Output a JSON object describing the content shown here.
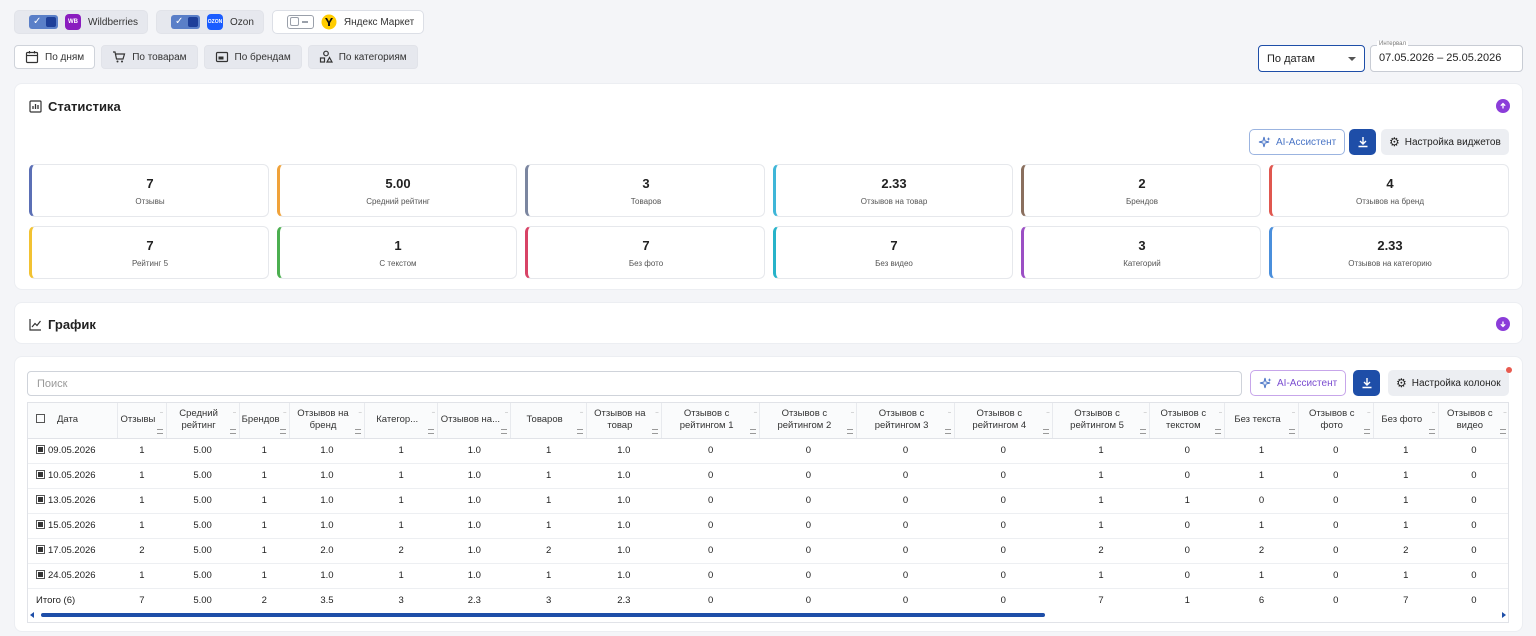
{
  "marketplaces": [
    {
      "name": "Wildberries",
      "enabled": true,
      "logo": "WB"
    },
    {
      "name": "Ozon",
      "enabled": true,
      "logo": "OZON"
    },
    {
      "name": "Яндекс Маркет",
      "enabled": false,
      "logo": ""
    }
  ],
  "views": [
    {
      "label": "По дням",
      "icon": "calendar-icon",
      "active": true
    },
    {
      "label": "По товарам",
      "icon": "cart-icon",
      "active": false
    },
    {
      "label": "По брендам",
      "icon": "brand-icon",
      "active": false
    },
    {
      "label": "По категориям",
      "icon": "category-icon",
      "active": false
    }
  ],
  "date_mode": {
    "value": "По датам"
  },
  "interval": {
    "label": "Интервал",
    "value": "07.05.2026 – 25.05.2026"
  },
  "stats": {
    "title": "Статистика",
    "ai_label": "AI-Ассистент",
    "settings_label": "Настройка виджетов",
    "tiles": [
      {
        "value": "7",
        "label": "Отзывы",
        "color": "#5b6fb5"
      },
      {
        "value": "5.00",
        "label": "Средний рейтинг",
        "color": "#f0a23a"
      },
      {
        "value": "3",
        "label": "Товаров",
        "color": "#7b86a0"
      },
      {
        "value": "2.33",
        "label": "Отзывов на товар",
        "color": "#3fb6d8"
      },
      {
        "value": "2",
        "label": "Брендов",
        "color": "#8a6f5e"
      },
      {
        "value": "4",
        "label": "Отзывов на бренд",
        "color": "#e0574f"
      },
      {
        "value": "7",
        "label": "Рейтинг 5",
        "color": "#f2c232"
      },
      {
        "value": "1",
        "label": "С текстом",
        "color": "#4caf50"
      },
      {
        "value": "7",
        "label": "Без фото",
        "color": "#d84366"
      },
      {
        "value": "7",
        "label": "Без видео",
        "color": "#27b3c9"
      },
      {
        "value": "3",
        "label": "Категорий",
        "color": "#9b4fc4"
      },
      {
        "value": "2.33",
        "label": "Отзывов на категорию",
        "color": "#4a8fdc"
      }
    ]
  },
  "chart": {
    "title": "График"
  },
  "table": {
    "search_placeholder": "Поиск",
    "ai_label": "AI-Ассистент",
    "settings_label": "Настройка колонок",
    "columns": [
      "Дата",
      "Отзывы",
      "Средний рейтинг",
      "Брендов",
      "Отзывов на бренд",
      "Категор...",
      "Отзывов на...",
      "Товаров",
      "Отзывов на товар",
      "Отзывов с рейтингом 1",
      "Отзывов с рейтингом 2",
      "Отзывов с рейтингом 3",
      "Отзывов с рейтингом 4",
      "Отзывов с рейтингом 5",
      "Отзывов с текстом",
      "Без текста",
      "Отзывов с фото",
      "Без фото",
      "Отзывов с видео"
    ],
    "rows": [
      [
        "09.05.2026",
        "1",
        "5.00",
        "1",
        "1.0",
        "1",
        "1.0",
        "1",
        "1.0",
        "0",
        "0",
        "0",
        "0",
        "1",
        "0",
        "1",
        "0",
        "1",
        "0"
      ],
      [
        "10.05.2026",
        "1",
        "5.00",
        "1",
        "1.0",
        "1",
        "1.0",
        "1",
        "1.0",
        "0",
        "0",
        "0",
        "0",
        "1",
        "0",
        "1",
        "0",
        "1",
        "0"
      ],
      [
        "13.05.2026",
        "1",
        "5.00",
        "1",
        "1.0",
        "1",
        "1.0",
        "1",
        "1.0",
        "0",
        "0",
        "0",
        "0",
        "1",
        "1",
        "0",
        "0",
        "1",
        "0"
      ],
      [
        "15.05.2026",
        "1",
        "5.00",
        "1",
        "1.0",
        "1",
        "1.0",
        "1",
        "1.0",
        "0",
        "0",
        "0",
        "0",
        "1",
        "0",
        "1",
        "0",
        "1",
        "0"
      ],
      [
        "17.05.2026",
        "2",
        "5.00",
        "1",
        "2.0",
        "2",
        "1.0",
        "2",
        "1.0",
        "0",
        "0",
        "0",
        "0",
        "2",
        "0",
        "2",
        "0",
        "2",
        "0"
      ],
      [
        "24.05.2026",
        "1",
        "5.00",
        "1",
        "1.0",
        "1",
        "1.0",
        "1",
        "1.0",
        "0",
        "0",
        "0",
        "0",
        "1",
        "0",
        "1",
        "0",
        "1",
        "0"
      ]
    ],
    "total": [
      "Итого (6)",
      "7",
      "5.00",
      "2",
      "3.5",
      "3",
      "2.3",
      "3",
      "2.3",
      "0",
      "0",
      "0",
      "0",
      "7",
      "1",
      "6",
      "0",
      "7",
      "0"
    ]
  }
}
